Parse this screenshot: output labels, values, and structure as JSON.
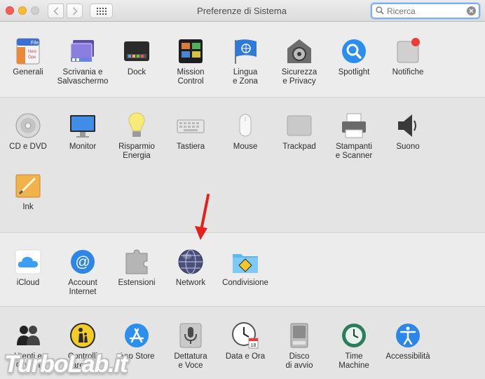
{
  "window": {
    "title": "Preferenze di Sistema"
  },
  "search": {
    "placeholder": "Ricerca",
    "value": ""
  },
  "sections": [
    [
      {
        "name": "pane-general",
        "icon": "general-icon",
        "label": "Generali"
      },
      {
        "name": "pane-desktop-screensaver",
        "icon": "desktop-screensaver-icon",
        "label": "Scrivania e\nSalvaschermo"
      },
      {
        "name": "pane-dock",
        "icon": "dock-icon",
        "label": "Dock"
      },
      {
        "name": "pane-mission-control",
        "icon": "mission-control-icon",
        "label": "Mission\nControl"
      },
      {
        "name": "pane-language-region",
        "icon": "language-region-icon",
        "label": "Lingua\ne Zona"
      },
      {
        "name": "pane-security-privacy",
        "icon": "security-privacy-icon",
        "label": "Sicurezza\ne Privacy"
      },
      {
        "name": "pane-spotlight",
        "icon": "spotlight-icon",
        "label": "Spotlight"
      },
      {
        "name": "pane-notifications",
        "icon": "notifications-icon",
        "label": "Notifiche"
      }
    ],
    [
      {
        "name": "pane-cd-dvd",
        "icon": "cd-dvd-icon",
        "label": "CD e DVD"
      },
      {
        "name": "pane-displays",
        "icon": "monitor-icon",
        "label": "Monitor"
      },
      {
        "name": "pane-energy-saver",
        "icon": "energy-saver-icon",
        "label": "Risparmio\nEnergia"
      },
      {
        "name": "pane-keyboard",
        "icon": "keyboard-icon",
        "label": "Tastiera"
      },
      {
        "name": "pane-mouse",
        "icon": "mouse-icon",
        "label": "Mouse"
      },
      {
        "name": "pane-trackpad",
        "icon": "trackpad-icon",
        "label": "Trackpad"
      },
      {
        "name": "pane-printers-scanners",
        "icon": "printer-icon",
        "label": "Stampanti\ne Scanner"
      },
      {
        "name": "pane-sound",
        "icon": "sound-icon",
        "label": "Suono"
      },
      {
        "name": "pane-ink",
        "icon": "ink-icon",
        "label": "Ink"
      }
    ],
    [
      {
        "name": "pane-icloud",
        "icon": "icloud-icon",
        "label": "iCloud"
      },
      {
        "name": "pane-internet-accounts",
        "icon": "internet-accounts-icon",
        "label": "Account\nInternet"
      },
      {
        "name": "pane-extensions",
        "icon": "extensions-icon",
        "label": "Estensioni"
      },
      {
        "name": "pane-network",
        "icon": "network-icon",
        "label": "Network"
      },
      {
        "name": "pane-sharing",
        "icon": "sharing-icon",
        "label": "Condivisione"
      }
    ],
    [
      {
        "name": "pane-users-groups",
        "icon": "users-groups-icon",
        "label": "Utenti e\nGruppi"
      },
      {
        "name": "pane-parental-controls",
        "icon": "parental-controls-icon",
        "label": "Controlli\nParentali"
      },
      {
        "name": "pane-app-store",
        "icon": "app-store-icon",
        "label": "App Store"
      },
      {
        "name": "pane-dictation-speech",
        "icon": "dictation-speech-icon",
        "label": "Dettatura\ne Voce"
      },
      {
        "name": "pane-date-time",
        "icon": "date-time-icon",
        "label": "Data e Ora"
      },
      {
        "name": "pane-startup-disk",
        "icon": "startup-disk-icon",
        "label": "Disco\ndi avvio"
      },
      {
        "name": "pane-time-machine",
        "icon": "time-machine-icon",
        "label": "Time\nMachine"
      },
      {
        "name": "pane-accessibility",
        "icon": "accessibility-icon",
        "label": "Accessibilità"
      }
    ]
  ],
  "watermark": {
    "text": "TurboLab.it"
  },
  "colors": {
    "annotation_arrow": "#e8201c",
    "search_focus": "#7faef2"
  }
}
